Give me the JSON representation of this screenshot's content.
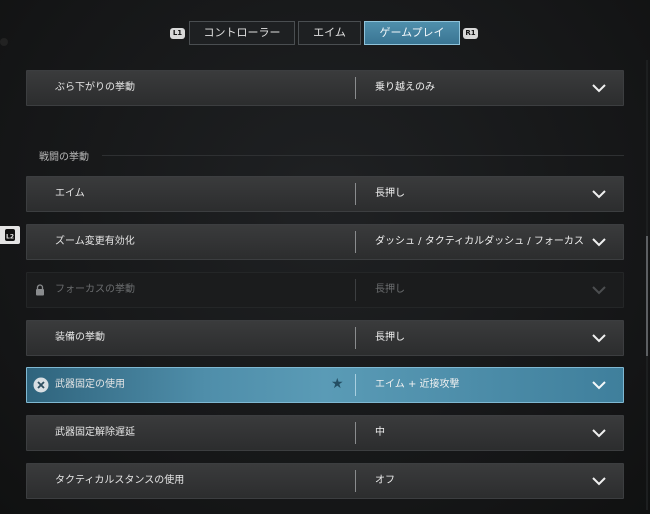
{
  "tabs": {
    "left_bumper": "L1",
    "right_bumper": "R1",
    "items": [
      {
        "label": "コントローラー",
        "active": false
      },
      {
        "label": "エイム",
        "active": false
      },
      {
        "label": "ゲームプレイ",
        "active": true
      }
    ]
  },
  "section": {
    "title": "戦闘の挙動"
  },
  "side_tab": {
    "label": "L2"
  },
  "rows": [
    {
      "label": "ぶら下がりの挙動",
      "value": "乗り越えのみ",
      "state": "normal"
    },
    {
      "label": "エイム",
      "value": "長押し",
      "state": "normal"
    },
    {
      "label": "ズーム変更有効化",
      "value": "ダッシュ / タクティカルダッシュ / フォーカス",
      "state": "normal"
    },
    {
      "label": "フォーカスの挙動",
      "value": "長押し",
      "state": "disabled"
    },
    {
      "label": "装備の挙動",
      "value": "長押し",
      "state": "normal"
    },
    {
      "label": "武器固定の使用",
      "value": "エイム + 近接攻撃",
      "state": "selected"
    },
    {
      "label": "武器固定解除遅延",
      "value": "中",
      "state": "normal"
    },
    {
      "label": "タクティカルスタンスの使用",
      "value": "オフ",
      "state": "normal"
    }
  ],
  "icons": {
    "lock": "lock-icon",
    "remove": "x-circle-icon",
    "favorite": "star-icon",
    "dropdown": "chevron-down-icon"
  },
  "colors": {
    "accent": "#4f8fac",
    "accent_border": "#8fc3da",
    "row_bg": "#333435",
    "disabled_text": "#6b6d6f"
  }
}
